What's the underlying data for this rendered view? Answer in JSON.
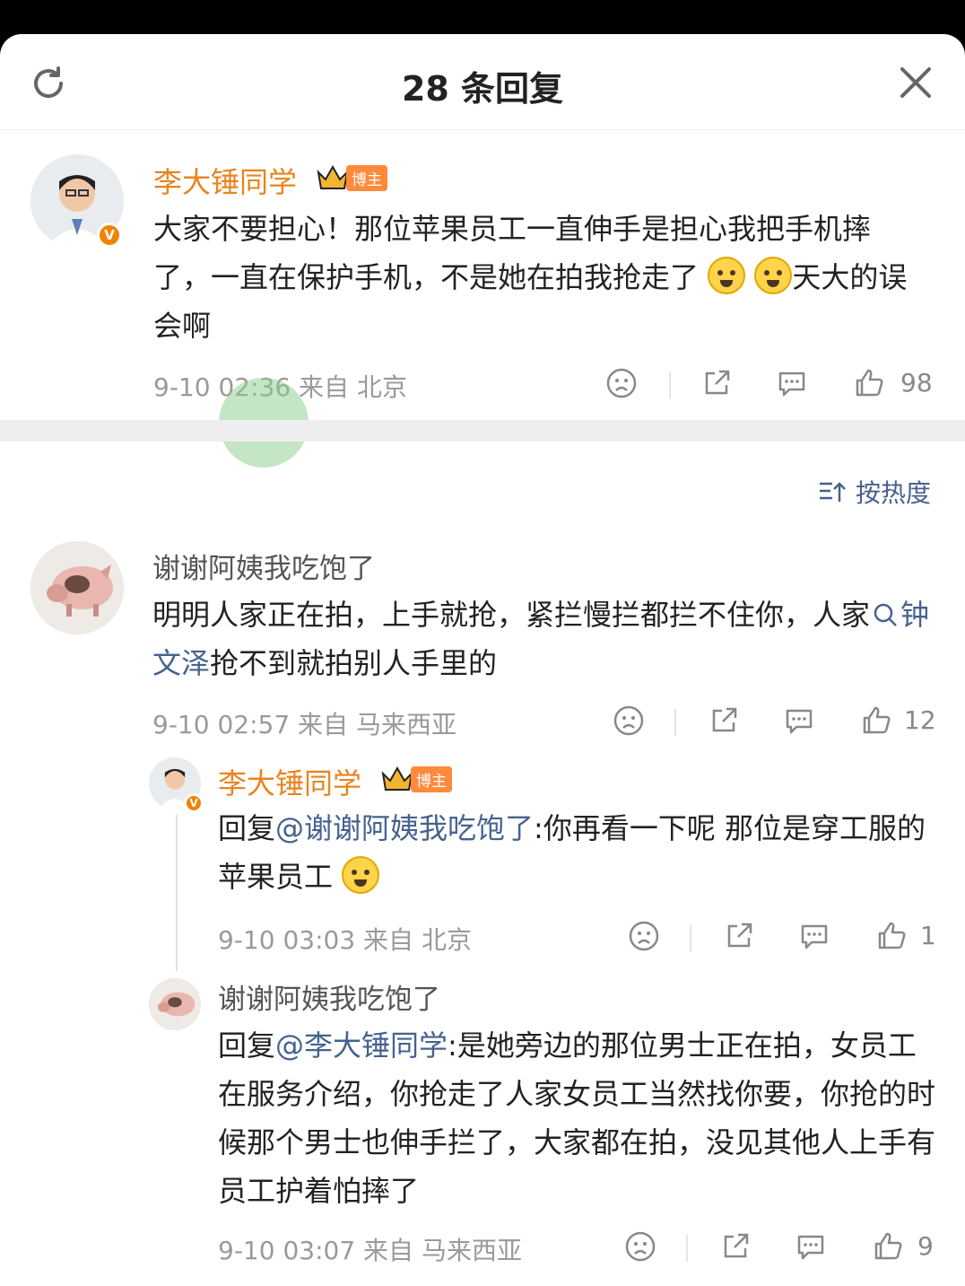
{
  "header": {
    "title": "28 条回复"
  },
  "main_post": {
    "author": "李大锤同学",
    "badge": "博主",
    "text": "大家不要担心！那位苹果员工一直伸手是担心我把手机摔了，一直在保护手机，不是她在拍我抢走了",
    "text_after_emoji": "天大的误会啊",
    "time": "9-10 02:36",
    "source": "来自 北京",
    "likes": "98"
  },
  "sort": {
    "label": "按热度"
  },
  "comment1": {
    "author": "谢谢阿姨我吃饱了",
    "text_part1": "明明人家正在拍，上手就抢，紧拦慢拦都拦不住你，人家",
    "search_link": "钟文泽",
    "text_part2": "抢不到就拍别人手里的",
    "time": "9-10 02:57",
    "source": "来自 马来西亚",
    "likes": "12"
  },
  "reply1": {
    "author": "李大锤同学",
    "badge": "博主",
    "prefix": "回复",
    "mention": "@谢谢阿姨我吃饱了",
    "text": ":你再看一下呢 那位是穿工服的苹果员工",
    "time": "9-10 03:03",
    "source": "来自 北京",
    "likes": "1"
  },
  "reply2": {
    "author": "谢谢阿姨我吃饱了",
    "prefix": "回复",
    "mention": "@李大锤同学",
    "text": ":是她旁边的那位男士正在拍，女员工在服务介绍，你抢走了人家女员工当然找你要，你抢的时候那个男士也伸手拦了，大家都在拍，没见其他人上手有员工护着怕摔了",
    "time": "9-10 03:07",
    "source": "来自 马来西亚",
    "likes": "9"
  }
}
